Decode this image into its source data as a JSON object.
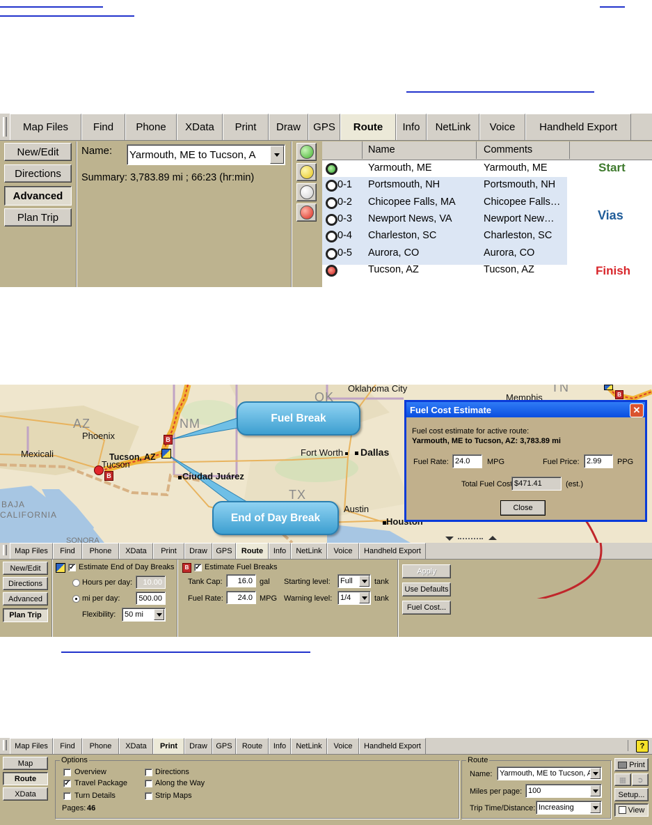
{
  "shot1": {
    "tabs": [
      "Map Files",
      "Find",
      "Phone",
      "XData",
      "Print",
      "Draw",
      "GPS",
      "Route",
      "Info",
      "NetLink",
      "Voice",
      "Handheld Export"
    ],
    "active_tab": "Route",
    "side_buttons": [
      "New/Edit",
      "Directions",
      "Advanced",
      "Plan Trip"
    ],
    "name_label": "Name:",
    "name_value": "Yarmouth, ME to Tucson, A",
    "summary": "Summary: 3,783.89 mi ; 66:23 (hr:min)",
    "col_name": "Name",
    "col_comments": "Comments",
    "rows": [
      {
        "id": "",
        "name": "Yarmouth, ME",
        "comment": "Yarmouth, ME",
        "kind": "start"
      },
      {
        "id": "0-1",
        "name": "Portsmouth, NH",
        "comment": "Portsmouth, NH",
        "kind": "via"
      },
      {
        "id": "0-2",
        "name": "Chicopee Falls, MA",
        "comment": "Chicopee Falls…",
        "kind": "via"
      },
      {
        "id": "0-3",
        "name": "Newport News, VA",
        "comment": "Newport New…",
        "kind": "via"
      },
      {
        "id": "0-4",
        "name": "Charleston, SC",
        "comment": "Charleston, SC",
        "kind": "via"
      },
      {
        "id": "0-5",
        "name": "Aurora, CO",
        "comment": "Aurora, CO",
        "kind": "via"
      },
      {
        "id": "",
        "name": "Tucson, AZ",
        "comment": "Tucson, AZ",
        "kind": "finish"
      }
    ],
    "start_label": "Start",
    "vias_label": "Vias",
    "finish_label": "Finish",
    "colors": {
      "start": "#3f7a2e",
      "vias": "#1f5c99",
      "finish": "#d8262b",
      "via_bg": "#dce6f4"
    }
  },
  "map": {
    "places": {
      "oklahoma_city": "Oklahoma City",
      "memphis": "Memphis",
      "phoenix": "Phoenix",
      "mexicali": "Mexicali",
      "tucson_az": "Tucson, AZ",
      "tucson": "Tucson",
      "fort_worth": "Fort Worth",
      "dallas": "Dallas",
      "ciudad_juarez": "Ciudad Juárez",
      "austin": "Austin",
      "houston": "Houston",
      "baja": "BAJA",
      "california": "CALIFORNIA",
      "sonora": "SONORA"
    },
    "states": {
      "az": "AZ",
      "nm": "NM",
      "ok": "OK",
      "tx": "TX",
      "tn": "TN"
    },
    "callout_fuel": "Fuel Break",
    "callout_eod": "End of Day Break"
  },
  "dialog": {
    "title": "Fuel Cost Estimate",
    "desc": "Fuel cost estimate for active route:",
    "route": "Yarmouth, ME to Tucson, AZ: 3,783.89 mi",
    "fuel_rate_label": "Fuel Rate:",
    "fuel_rate": "24.0",
    "mpg": "MPG",
    "fuel_price_label": "Fuel Price:",
    "fuel_price": "2.99",
    "ppg": "PPG",
    "total_label": "Total Fuel Cost:",
    "total": "$471.41",
    "est": "(est.)",
    "close": "Close"
  },
  "shot2": {
    "tabs": [
      "Map Files",
      "Find",
      "Phone",
      "XData",
      "Print",
      "Draw",
      "GPS",
      "Route",
      "Info",
      "NetLink",
      "Voice",
      "Handheld Export"
    ],
    "active_tab": "Route",
    "side_buttons": [
      "New/Edit",
      "Directions",
      "Advanced",
      "Plan Trip"
    ],
    "eod_label": "Estimate End of Day Breaks",
    "hours_label": "Hours per day:",
    "hours_value": "10.00",
    "mi_label": "mi per day:",
    "mi_value": "500.00",
    "flex_label": "Flexibility:",
    "flex_value": "50 mi",
    "fuel_label": "Estimate Fuel Breaks",
    "tank_label": "Tank Cap:",
    "tank_value": "16.0",
    "gal": "gal",
    "rate_label": "Fuel Rate:",
    "rate_value": "24.0",
    "mpg": "MPG",
    "start_label": "Starting level:",
    "start_value": "Full",
    "warn_label": "Warning level:",
    "warn_value": "1/4",
    "tank": "tank",
    "apply": "Apply",
    "defaults": "Use Defaults",
    "fuelcost": "Fuel Cost..."
  },
  "shot3": {
    "tabs": [
      "Map Files",
      "Find",
      "Phone",
      "XData",
      "Print",
      "Draw",
      "GPS",
      "Route",
      "Info",
      "NetLink",
      "Voice",
      "Handheld Export"
    ],
    "active_tab": "Print",
    "side_buttons": [
      "Map",
      "Route",
      "XData"
    ],
    "options_title": "Options",
    "opt_overview": "Overview",
    "opt_travel": "Travel Package",
    "opt_turn": "Turn Details",
    "opt_directions": "Directions",
    "opt_along": "Along the Way",
    "opt_strip": "Strip Maps",
    "pages_label": "Pages:",
    "pages_value": "46",
    "route_title": "Route",
    "name_label": "Name:",
    "name_value": "Yarmouth, ME to Tucson, A",
    "mpp_label": "Miles per page:",
    "mpp_value": "100",
    "ttd_label": "Trip Time/Distance:",
    "ttd_value": "Increasing",
    "print": "Print",
    "setup": "Setup...",
    "view": "View",
    "help": "?"
  }
}
